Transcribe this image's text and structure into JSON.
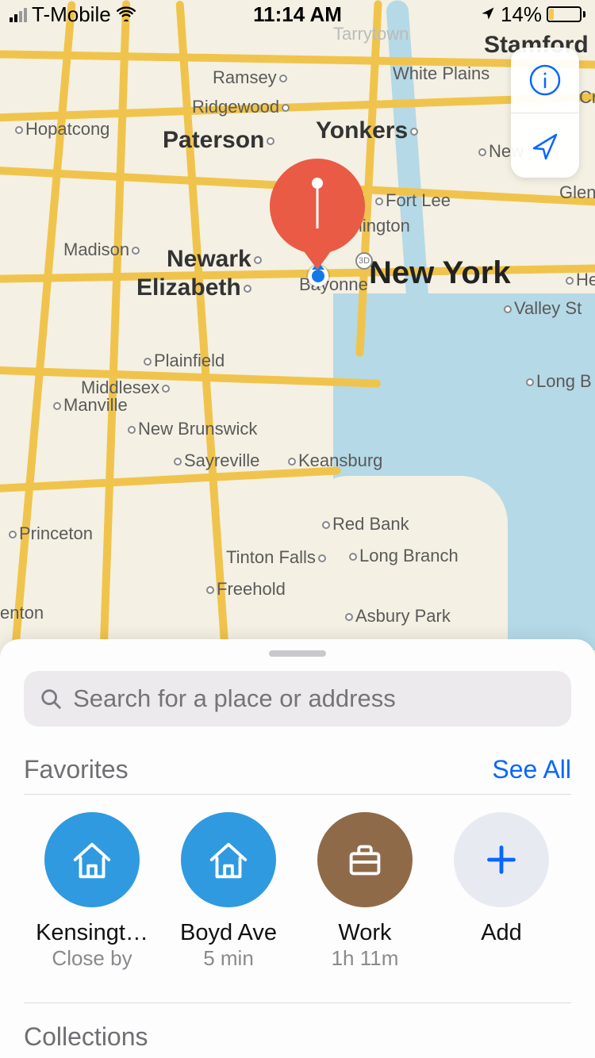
{
  "status": {
    "carrier": "T-Mobile",
    "time": "11:14 AM",
    "battery_pct": "14%"
  },
  "map": {
    "labels": {
      "stamford": "Stamford",
      "white_plains": "White Plains",
      "ramsey": "Ramsey",
      "ridgewood": "Ridgewood",
      "hopatcong": "Hopatcong",
      "paterson": "Paterson",
      "yonkers": "Yonkers",
      "new_r": "New",
      "glen": "Glen",
      "fort_lee": "Fort Lee",
      "lington": "lington",
      "madison": "Madison",
      "newark": "Newark",
      "new_york": "New York",
      "elizabeth": "Elizabeth",
      "bayonne": "Bayonne",
      "hen": "Hen",
      "valley_st": "Valley St",
      "plainfield": "Plainfield",
      "middlesex": "Middlesex",
      "manville": "Manville",
      "long_b": "Long B",
      "new_brunswick": "New Brunswick",
      "sayreville": "Sayreville",
      "keansburg": "Keansburg",
      "princeton": "Princeton",
      "red_bank": "Red Bank",
      "tinton_falls": "Tinton Falls",
      "long_branch": "Long Branch",
      "freehold": "Freehold",
      "enton": "enton",
      "asbury_park": "Asbury Park",
      "badge3d": "3D",
      "ch_edge": "Cr",
      "tarrytown": "Tarrytown"
    }
  },
  "sheet": {
    "search_placeholder": "Search for a place or address",
    "favorites_title": "Favorites",
    "see_all": "See All",
    "favorites": [
      {
        "label": "Kensingt…",
        "sub": "Close by"
      },
      {
        "label": "Boyd Ave",
        "sub": "5 min"
      },
      {
        "label": "Work",
        "sub": "1h 11m"
      },
      {
        "label": "Add",
        "sub": ""
      }
    ],
    "collections_title": "Collections"
  }
}
